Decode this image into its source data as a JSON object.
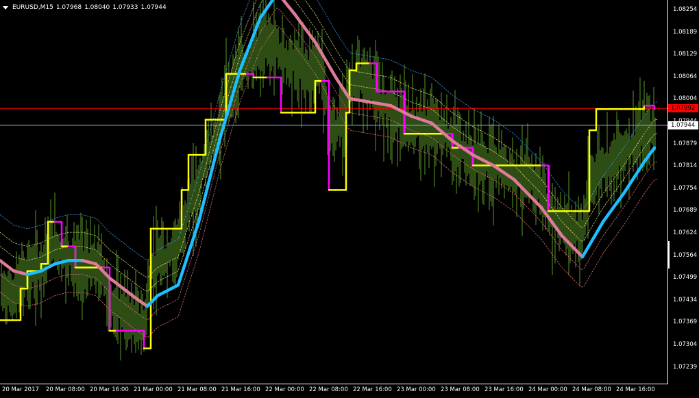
{
  "header": {
    "symbol": "EURUSD,M15",
    "open": "1.07968",
    "high": "1.08040",
    "low": "1.07933",
    "close": "1.07944"
  },
  "price_axis": {
    "ticks": [
      "1.08254",
      "1.08189",
      "1.08129",
      "1.08064",
      "1.08004",
      "1.07944",
      "1.07879",
      "1.07814",
      "1.07754",
      "1.07689",
      "1.07624",
      "1.07564",
      "1.07499",
      "1.07434",
      "1.07369",
      "1.07304",
      "1.07239"
    ],
    "bid_tag": {
      "value": "1.07944",
      "color": "#ffffff",
      "text_color": "#000000"
    },
    "ask_tag": {
      "value": "1.07992",
      "color": "#ff0000",
      "text_color": "#000000"
    }
  },
  "time_axis": {
    "ticks": [
      "20 Mar 2017",
      "20 Mar 08:00",
      "20 Mar 16:00",
      "21 Mar 00:00",
      "21 Mar 08:00",
      "21 Mar 16:00",
      "22 Mar 00:00",
      "22 Mar 08:00",
      "22 Mar 16:00",
      "23 Mar 00:00",
      "23 Mar 08:00",
      "23 Mar 16:00",
      "24 Mar 00:00",
      "24 Mar 08:00",
      "24 Mar 16:00"
    ]
  },
  "colors": {
    "background": "#000000",
    "candles": "#5a9a2a",
    "ma_main_up": "#1ebeff",
    "ma_main_down": "#e07a9a",
    "step_up": "#ffff00",
    "step_down": "#ff00ff",
    "ask_line": "#ff0000",
    "bid_line": "#8fb4d8"
  },
  "chart_data": {
    "type": "line",
    "title": "EURUSD,M15",
    "ylim": [
      1.0721,
      1.083
    ],
    "series": [
      {
        "key": "ma_main",
        "x": [
          0,
          20,
          40,
          60,
          80,
          100,
          120,
          140,
          160,
          180,
          200,
          215,
          230,
          260,
          290,
          320,
          350,
          380,
          405,
          430,
          460,
          490,
          510,
          540,
          570,
          600,
          630,
          660,
          690,
          720,
          750,
          790,
          820,
          850,
          880,
          910,
          940,
          955
        ],
        "values": [
          1.0756,
          1.0753,
          1.0752,
          1.0753,
          1.0755,
          1.0756,
          1.0756,
          1.0755,
          1.0751,
          1.0748,
          1.0745,
          1.0743,
          1.0746,
          1.0749,
          1.0767,
          1.079,
          1.081,
          1.0825,
          1.0832,
          1.0826,
          1.0818,
          1.0808,
          1.0802,
          1.0801,
          1.08,
          1.0797,
          1.0795,
          1.079,
          1.0786,
          1.0783,
          1.0779,
          1.0771,
          1.0763,
          1.0757,
          1.0767,
          1.0775,
          1.0784,
          1.0788
        ]
      },
      {
        "key": "step",
        "x": [
          0,
          20,
          30,
          40,
          60,
          70,
          80,
          90,
          100,
          110,
          150,
          160,
          170,
          210,
          220,
          240,
          265,
          275,
          290,
          300,
          320,
          330,
          360,
          370,
          390,
          410,
          420,
          450,
          460,
          470,
          480,
          490,
          505,
          510,
          520,
          540,
          550,
          590,
          600,
          610,
          650,
          660,
          670,
          690,
          790,
          800,
          810,
          850,
          860,
          870,
          920,
          940,
          955
        ],
        "values": [
          1.0739,
          1.0739,
          1.0748,
          1.0753,
          1.0755,
          1.0767,
          1.0767,
          1.076,
          1.076,
          1.0754,
          1.0754,
          1.0736,
          1.0736,
          1.0731,
          1.0765,
          1.0765,
          1.0776,
          1.0786,
          1.0786,
          1.0796,
          1.0796,
          1.0809,
          1.0809,
          1.0808,
          1.0808,
          1.0798,
          1.0798,
          1.0798,
          1.0807,
          1.0807,
          1.0776,
          1.0776,
          1.0798,
          1.081,
          1.0812,
          1.0812,
          1.0804,
          1.0792,
          1.0792,
          1.0792,
          1.0792,
          1.0788,
          1.0788,
          1.0783,
          1.0783,
          1.077,
          1.077,
          1.077,
          1.0793,
          1.0799,
          1.0799,
          1.08,
          1.0799
        ]
      }
    ],
    "bands": [
      {
        "offset": 0.0013,
        "color": "#3a8fd0"
      },
      {
        "offset": 0.0008,
        "color": "#d0d070"
      },
      {
        "offset": 0.0004,
        "color": "#d0d070"
      },
      {
        "offset": -0.0004,
        "color": "#d07070"
      },
      {
        "offset": -0.0009,
        "color": "#d07070"
      }
    ],
    "ask_price": 1.07992,
    "bid_price": 1.07944
  }
}
